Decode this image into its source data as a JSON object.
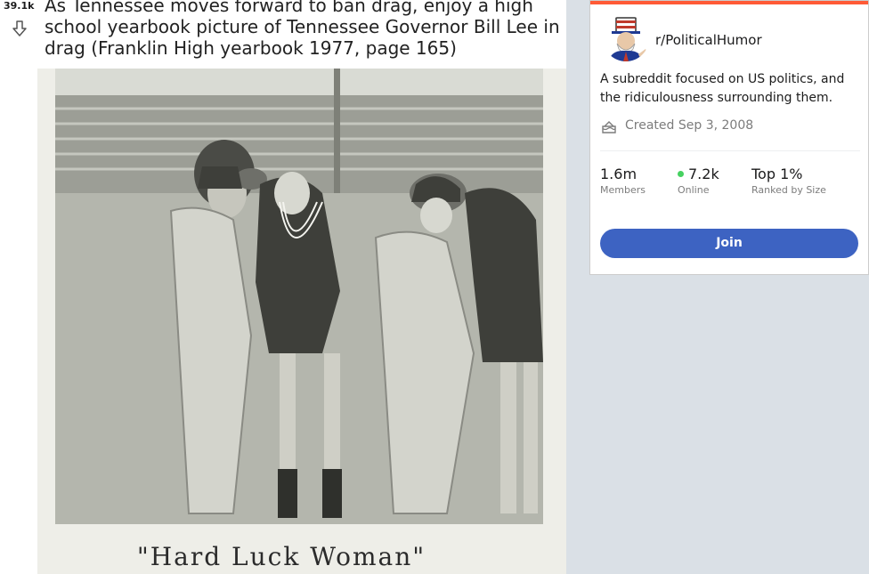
{
  "post": {
    "score": "39.1k",
    "title": "As Tennessee moves forward to ban drag, enjoy a high school yearbook picture of Tennessee Governor Bill Lee in drag (Franklin High yearbook 1977, page 165)",
    "image": {
      "caption": "\"Hard Luck Woman\""
    }
  },
  "sidebar": {
    "subreddit": "r/PoliticalHumor",
    "description": "A subreddit focused on US politics, and the ridiculousness surrounding them.",
    "created": "Created Sep 3, 2008",
    "stats": [
      {
        "value": "1.6m",
        "label": "Members"
      },
      {
        "value": "7.2k",
        "label": "Online"
      },
      {
        "value": "Top 1%",
        "label": "Ranked by Size"
      }
    ],
    "join_label": "Join"
  },
  "colors": {
    "accent": "#ff5a36",
    "join_button": "#3d63c2",
    "online_dot": "#46d160",
    "page_bg": "#dae0e6"
  },
  "icons": {
    "downvote": "down-arrow-icon",
    "cake": "cake-icon"
  }
}
